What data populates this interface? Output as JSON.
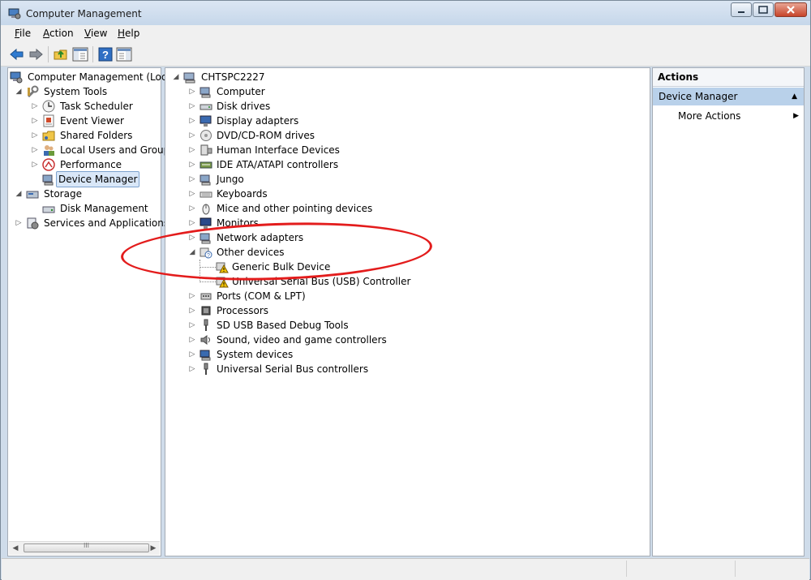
{
  "window": {
    "title": "Computer Management"
  },
  "menu": {
    "file": "File",
    "action": "Action",
    "view": "View",
    "help": "Help"
  },
  "toolbar": {
    "icons": [
      "back-arrow-icon",
      "forward-arrow-icon",
      "up-folder-icon",
      "show-hide-tree-icon",
      "help-icon",
      "show-hide-action-pane-icon"
    ]
  },
  "left_tree": {
    "root": "Computer Management (Local",
    "system_tools": "System Tools",
    "task_scheduler": "Task Scheduler",
    "event_viewer": "Event Viewer",
    "shared_folders": "Shared Folders",
    "local_users": "Local Users and Groups",
    "performance": "Performance",
    "device_manager": "Device Manager",
    "storage": "Storage",
    "disk_management": "Disk Management",
    "services_apps": "Services and Applications"
  },
  "device_tree": {
    "root": "CHTSPC2227",
    "categories": [
      "Computer",
      "Disk drives",
      "Display adapters",
      "DVD/CD-ROM drives",
      "Human Interface Devices",
      "IDE ATA/ATAPI controllers",
      "Jungo",
      "Keyboards",
      "Mice and other pointing devices",
      "Monitors",
      "Network adapters",
      "Other devices",
      "Ports (COM & LPT)",
      "Processors",
      "SD USB Based Debug Tools",
      "Sound, video and game controllers",
      "System devices",
      "Universal Serial Bus controllers"
    ],
    "other_devices_children": [
      "Generic Bulk Device",
      "Universal Serial Bus (USB) Controller"
    ]
  },
  "actions": {
    "header": "Actions",
    "section": "Device Manager",
    "more_actions": "More Actions"
  },
  "scrollbar_glyph": "III",
  "colors": {
    "titlebar": "#c6d7ea",
    "selection": "#d9e7f8",
    "actions_section": "#b9d1ea",
    "annotation_red": "#e31c1c",
    "warning_yellow": "#f2c200"
  }
}
